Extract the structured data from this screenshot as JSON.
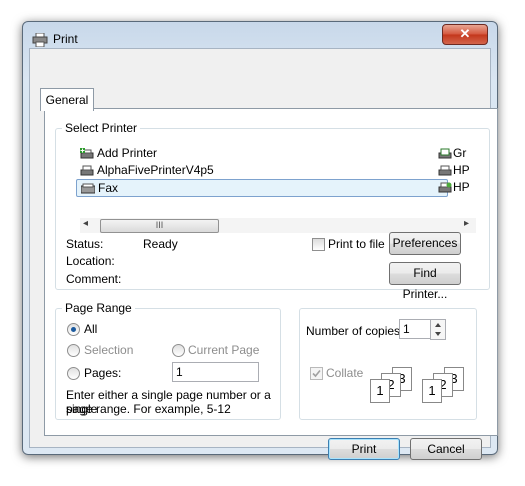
{
  "window": {
    "title": "Print",
    "close_glyph": "✕"
  },
  "tabs": [
    "General"
  ],
  "select_printer": {
    "legend": "Select Printer",
    "printers_left": [
      "Add Printer",
      "AlphaFivePrinterV4p5",
      "Fax"
    ],
    "printers_right": [
      "Gr",
      "HP",
      "HP"
    ],
    "scroll_left": "◂",
    "scroll_right": "▸",
    "thumb_grip": "III",
    "status_label": "Status:",
    "status_value": "Ready",
    "location_label": "Location:",
    "comment_label": "Comment:",
    "print_to_file": "Print to file",
    "preferences": "Preferences",
    "find_printer": "Find Printer..."
  },
  "page_range": {
    "legend": "Page Range",
    "all": "All",
    "selection": "Selection",
    "current_page": "Current Page",
    "pages": "Pages:",
    "pages_value": "1",
    "hint_line1": "Enter either a single page number or a single",
    "hint_line2": "page range.  For example, 5-12"
  },
  "copies": {
    "label": "Number of copies:",
    "value": "1",
    "collate": "Collate",
    "collate_pages": [
      "1",
      "2",
      "3"
    ]
  },
  "footer": {
    "print": "Print",
    "cancel": "Cancel"
  },
  "colors": {
    "selection_fill": "#e5f3fb",
    "selection_border": "#7da2ce",
    "close_red": "#c3361b"
  }
}
